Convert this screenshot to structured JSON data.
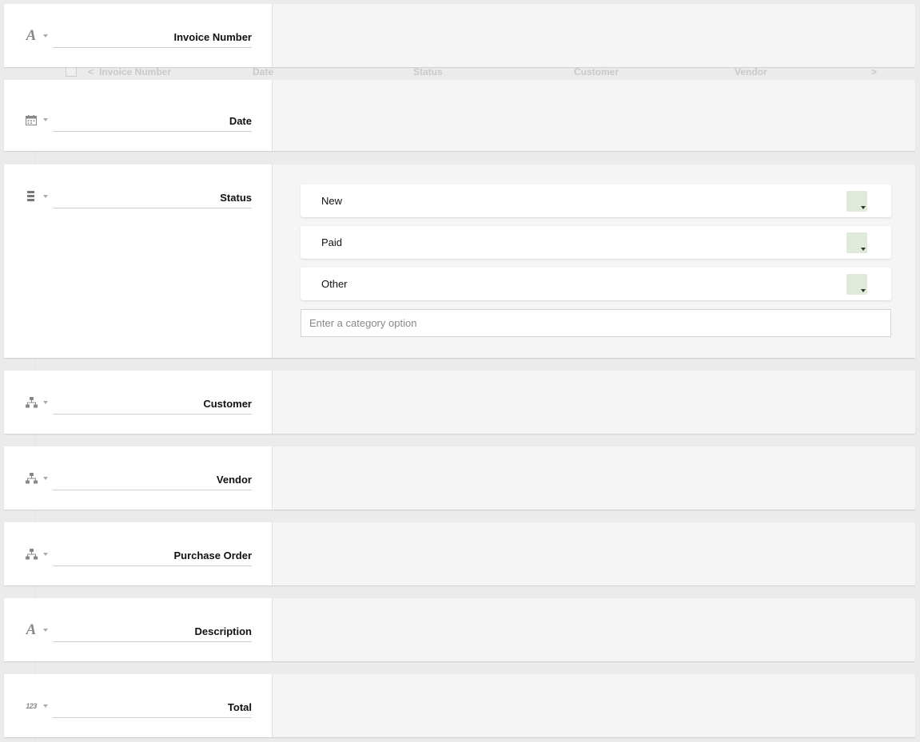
{
  "ghost_header": {
    "columns": [
      "Invoice Number",
      "Date",
      "Status",
      "Customer",
      "Vendor"
    ],
    "prev_arrow": "<",
    "next_arrow": ">"
  },
  "fields": [
    {
      "name": "Invoice Number",
      "type_icon": "text-type-icon"
    },
    {
      "name": "Date",
      "type_icon": "calendar-icon"
    },
    {
      "name": "Status",
      "type_icon": "category-list-icon"
    },
    {
      "name": "Customer",
      "type_icon": "link-hierarchy-icon"
    },
    {
      "name": "Vendor",
      "type_icon": "link-hierarchy-icon"
    },
    {
      "name": "Purchase Order",
      "type_icon": "link-hierarchy-icon"
    },
    {
      "name": "Description",
      "type_icon": "text-type-icon"
    },
    {
      "name": "Total",
      "type_icon": "number-type-icon"
    }
  ],
  "icons": {
    "text": "A",
    "number": "123"
  },
  "status_options": [
    {
      "label": "New",
      "color": "#dfeadb"
    },
    {
      "label": "Paid",
      "color": "#dfeadb"
    },
    {
      "label": "Other",
      "color": "#dfeadb"
    }
  ],
  "category_input": {
    "value": "",
    "placeholder": "Enter a category option"
  }
}
